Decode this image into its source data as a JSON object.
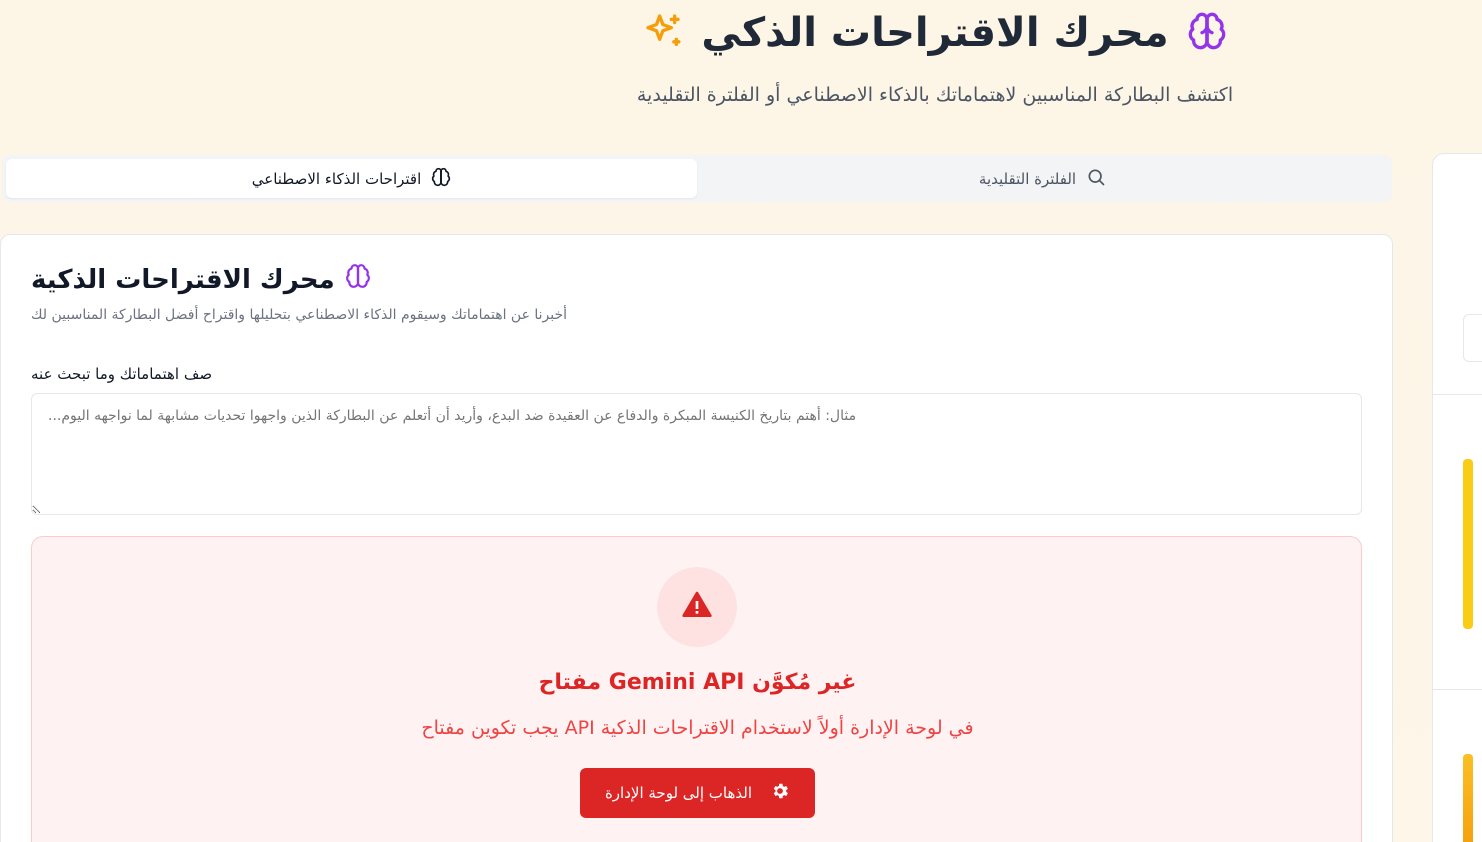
{
  "header": {
    "title": "محرك الاقتراحات الذكي",
    "subtitle": "اكتشف البطاركة المناسبين لاهتماماتك بالذكاء الاصطناعي أو الفلترة التقليدية"
  },
  "tabs": [
    {
      "label": "اقتراحات الذكاء الاصطناعي",
      "icon": "brain-icon",
      "active": true
    },
    {
      "label": "الفلترة التقليدية",
      "icon": "search-icon",
      "active": false
    }
  ],
  "card": {
    "title": "محرك الاقتراحات الذكية",
    "description": "أخبرنا عن اهتماماتك وسيقوم الذكاء الاصطناعي بتحليلها واقتراح أفضل البطاركة المناسبين لك",
    "field_label": "صف اهتماماتك وما تبحث عنه",
    "textarea_placeholder": "مثال: أهتم بتاريخ الكنيسة المبكرة والدفاع عن العقيدة ضد البدع، وأريد أن أتعلم عن البطاركة الذين واجهوا تحديات مشابهة لما نواجهه اليوم..."
  },
  "alert": {
    "title": "غير مُكوَّن Gemini API مفتاح",
    "text": "في لوحة الإدارة أولاً لاستخدام الاقتراحات الذكية API يجب تكوين مفتاح",
    "button_label": "الذهاب إلى لوحة الإدارة"
  },
  "colors": {
    "brain": "#9333ea",
    "sparkle": "#f59e0b",
    "danger": "#dc2626"
  }
}
